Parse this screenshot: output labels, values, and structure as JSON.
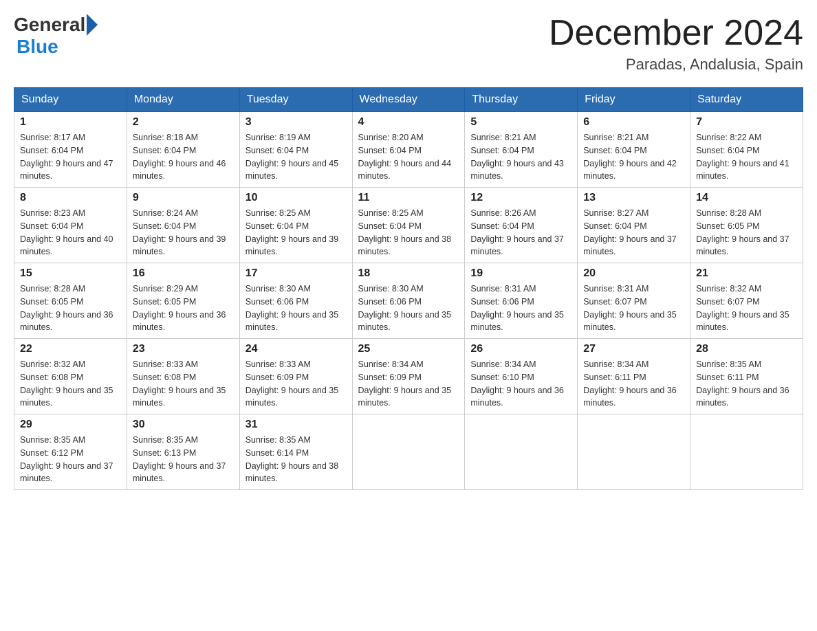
{
  "header": {
    "logo_general": "General",
    "logo_blue": "Blue",
    "title": "December 2024",
    "location": "Paradas, Andalusia, Spain"
  },
  "days_of_week": [
    "Sunday",
    "Monday",
    "Tuesday",
    "Wednesday",
    "Thursday",
    "Friday",
    "Saturday"
  ],
  "weeks": [
    [
      {
        "day": "1",
        "sunrise": "8:17 AM",
        "sunset": "6:04 PM",
        "daylight": "9 hours and 47 minutes."
      },
      {
        "day": "2",
        "sunrise": "8:18 AM",
        "sunset": "6:04 PM",
        "daylight": "9 hours and 46 minutes."
      },
      {
        "day": "3",
        "sunrise": "8:19 AM",
        "sunset": "6:04 PM",
        "daylight": "9 hours and 45 minutes."
      },
      {
        "day": "4",
        "sunrise": "8:20 AM",
        "sunset": "6:04 PM",
        "daylight": "9 hours and 44 minutes."
      },
      {
        "day": "5",
        "sunrise": "8:21 AM",
        "sunset": "6:04 PM",
        "daylight": "9 hours and 43 minutes."
      },
      {
        "day": "6",
        "sunrise": "8:21 AM",
        "sunset": "6:04 PM",
        "daylight": "9 hours and 42 minutes."
      },
      {
        "day": "7",
        "sunrise": "8:22 AM",
        "sunset": "6:04 PM",
        "daylight": "9 hours and 41 minutes."
      }
    ],
    [
      {
        "day": "8",
        "sunrise": "8:23 AM",
        "sunset": "6:04 PM",
        "daylight": "9 hours and 40 minutes."
      },
      {
        "day": "9",
        "sunrise": "8:24 AM",
        "sunset": "6:04 PM",
        "daylight": "9 hours and 39 minutes."
      },
      {
        "day": "10",
        "sunrise": "8:25 AM",
        "sunset": "6:04 PM",
        "daylight": "9 hours and 39 minutes."
      },
      {
        "day": "11",
        "sunrise": "8:25 AM",
        "sunset": "6:04 PM",
        "daylight": "9 hours and 38 minutes."
      },
      {
        "day": "12",
        "sunrise": "8:26 AM",
        "sunset": "6:04 PM",
        "daylight": "9 hours and 37 minutes."
      },
      {
        "day": "13",
        "sunrise": "8:27 AM",
        "sunset": "6:04 PM",
        "daylight": "9 hours and 37 minutes."
      },
      {
        "day": "14",
        "sunrise": "8:28 AM",
        "sunset": "6:05 PM",
        "daylight": "9 hours and 37 minutes."
      }
    ],
    [
      {
        "day": "15",
        "sunrise": "8:28 AM",
        "sunset": "6:05 PM",
        "daylight": "9 hours and 36 minutes."
      },
      {
        "day": "16",
        "sunrise": "8:29 AM",
        "sunset": "6:05 PM",
        "daylight": "9 hours and 36 minutes."
      },
      {
        "day": "17",
        "sunrise": "8:30 AM",
        "sunset": "6:06 PM",
        "daylight": "9 hours and 35 minutes."
      },
      {
        "day": "18",
        "sunrise": "8:30 AM",
        "sunset": "6:06 PM",
        "daylight": "9 hours and 35 minutes."
      },
      {
        "day": "19",
        "sunrise": "8:31 AM",
        "sunset": "6:06 PM",
        "daylight": "9 hours and 35 minutes."
      },
      {
        "day": "20",
        "sunrise": "8:31 AM",
        "sunset": "6:07 PM",
        "daylight": "9 hours and 35 minutes."
      },
      {
        "day": "21",
        "sunrise": "8:32 AM",
        "sunset": "6:07 PM",
        "daylight": "9 hours and 35 minutes."
      }
    ],
    [
      {
        "day": "22",
        "sunrise": "8:32 AM",
        "sunset": "6:08 PM",
        "daylight": "9 hours and 35 minutes."
      },
      {
        "day": "23",
        "sunrise": "8:33 AM",
        "sunset": "6:08 PM",
        "daylight": "9 hours and 35 minutes."
      },
      {
        "day": "24",
        "sunrise": "8:33 AM",
        "sunset": "6:09 PM",
        "daylight": "9 hours and 35 minutes."
      },
      {
        "day": "25",
        "sunrise": "8:34 AM",
        "sunset": "6:09 PM",
        "daylight": "9 hours and 35 minutes."
      },
      {
        "day": "26",
        "sunrise": "8:34 AM",
        "sunset": "6:10 PM",
        "daylight": "9 hours and 36 minutes."
      },
      {
        "day": "27",
        "sunrise": "8:34 AM",
        "sunset": "6:11 PM",
        "daylight": "9 hours and 36 minutes."
      },
      {
        "day": "28",
        "sunrise": "8:35 AM",
        "sunset": "6:11 PM",
        "daylight": "9 hours and 36 minutes."
      }
    ],
    [
      {
        "day": "29",
        "sunrise": "8:35 AM",
        "sunset": "6:12 PM",
        "daylight": "9 hours and 37 minutes."
      },
      {
        "day": "30",
        "sunrise": "8:35 AM",
        "sunset": "6:13 PM",
        "daylight": "9 hours and 37 minutes."
      },
      {
        "day": "31",
        "sunrise": "8:35 AM",
        "sunset": "6:14 PM",
        "daylight": "9 hours and 38 minutes."
      },
      null,
      null,
      null,
      null
    ]
  ]
}
